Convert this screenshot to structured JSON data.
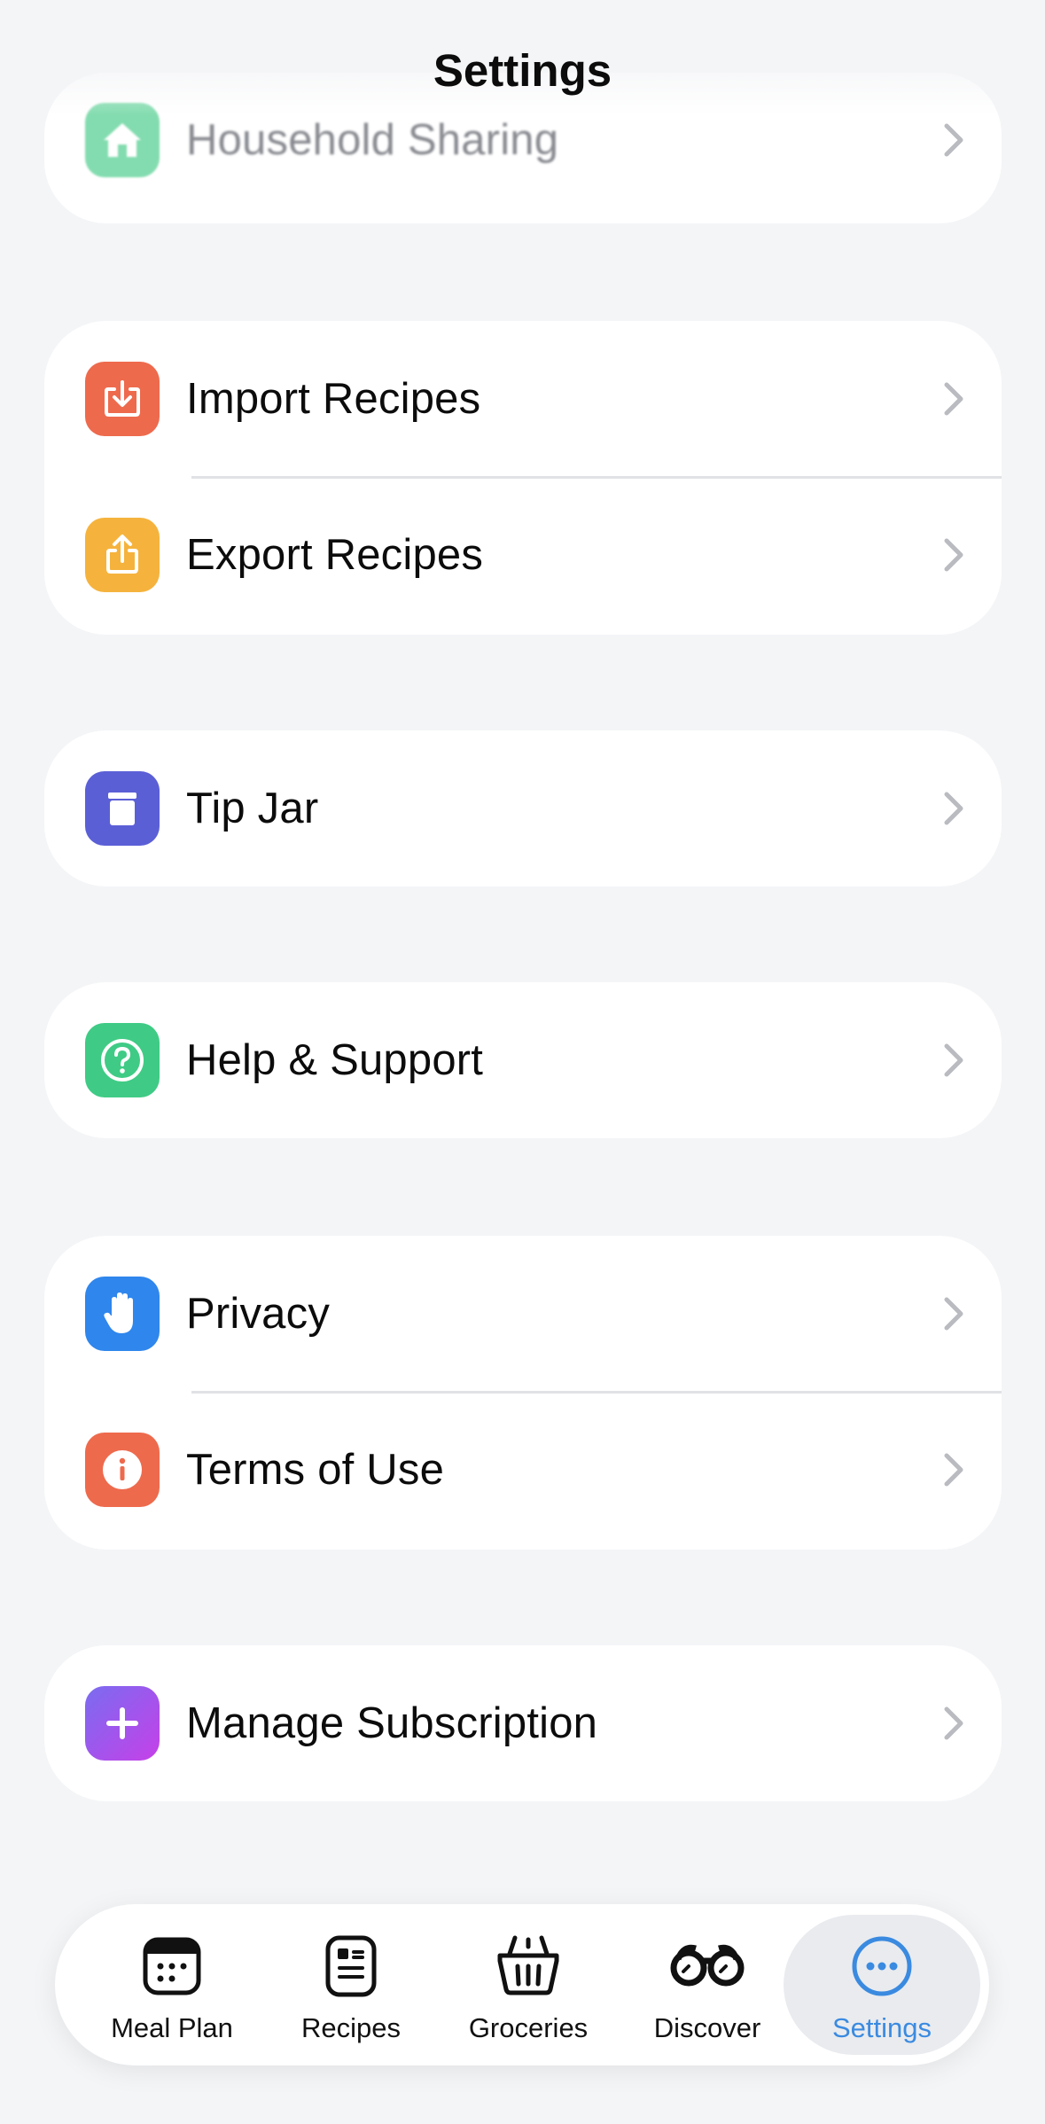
{
  "header": {
    "title": "Settings"
  },
  "colors": {
    "household": "#4fce8e",
    "import": "#ee6a4d",
    "export": "#f5b33d",
    "tipjar": "#5b5fd6",
    "help": "#3fcb85",
    "privacy": "#2f86ec",
    "terms": "#ee6a4d",
    "subscription": "#a445ef",
    "accent": "#3a8ae0"
  },
  "groups": {
    "household": {
      "label": "Household Sharing",
      "icon": "house-icon"
    },
    "recipes": {
      "import_label": "Import Recipes",
      "import_icon": "import-tray-icon",
      "export_label": "Export Recipes",
      "export_icon": "share-icon"
    },
    "tipjar": {
      "label": "Tip Jar",
      "icon": "jar-icon"
    },
    "help": {
      "label": "Help & Support",
      "icon": "question-circle-icon"
    },
    "legal": {
      "privacy_label": "Privacy",
      "privacy_icon": "hand-raised-icon",
      "terms_label": "Terms of Use",
      "terms_icon": "info-circle-icon"
    },
    "subscription": {
      "label": "Manage Subscription",
      "icon": "plus-icon"
    }
  },
  "tabbar": {
    "tabs": [
      {
        "label": "Meal Plan",
        "icon": "calendar-icon"
      },
      {
        "label": "Recipes",
        "icon": "recipe-card-icon"
      },
      {
        "label": "Groceries",
        "icon": "basket-icon"
      },
      {
        "label": "Discover",
        "icon": "binoculars-icon"
      },
      {
        "label": "Settings",
        "icon": "ellipsis-circle-icon",
        "selected": true
      }
    ]
  }
}
